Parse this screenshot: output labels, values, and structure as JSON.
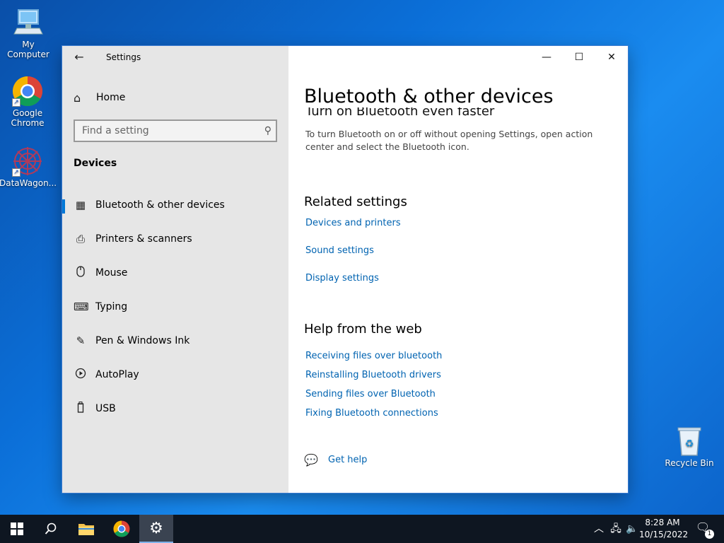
{
  "desktop": {
    "icons": [
      {
        "label": "My Computer",
        "icon": "computer-icon"
      },
      {
        "label": "Google Chrome",
        "icon": "chrome-icon"
      },
      {
        "label": "DataWagon...",
        "icon": "datawagon-icon"
      },
      {
        "label": "Recycle Bin",
        "icon": "recycle-bin-icon"
      }
    ]
  },
  "window": {
    "title": "Settings",
    "back_icon": "back-arrow-icon",
    "home_label": "Home",
    "search_placeholder": "Find a setting",
    "section": "Devices",
    "nav": [
      {
        "label": "Bluetooth & other devices",
        "icon": "bluetooth-devices-icon",
        "active": true
      },
      {
        "label": "Printers & scanners",
        "icon": "printer-icon",
        "active": false
      },
      {
        "label": "Mouse",
        "icon": "mouse-icon",
        "active": false
      },
      {
        "label": "Typing",
        "icon": "keyboard-icon",
        "active": false
      },
      {
        "label": "Pen & Windows Ink",
        "icon": "pen-icon",
        "active": false
      },
      {
        "label": "AutoPlay",
        "icon": "autoplay-icon",
        "active": false
      },
      {
        "label": "USB",
        "icon": "usb-icon",
        "active": false
      }
    ],
    "controls": {
      "minimize": "minimize-icon",
      "maximize": "maximize-icon",
      "close": "close-icon"
    }
  },
  "content": {
    "title": "Bluetooth & other devices",
    "cutoff_heading": "Turn on Bluetooth even faster",
    "description": "To turn Bluetooth on or off without opening Settings, open action center and select the Bluetooth icon.",
    "related_heading": "Related settings",
    "related_links": [
      "Devices and printers",
      "Sound settings",
      "Display settings"
    ],
    "help_heading": "Help from the web",
    "help_links": [
      "Receiving files over bluetooth",
      "Reinstalling Bluetooth drivers",
      "Sending files over Bluetooth",
      "Fixing Bluetooth connections"
    ],
    "get_help": "Get help"
  },
  "taskbar": {
    "time": "8:28 AM",
    "date": "10/15/2022",
    "notification_count": "1"
  },
  "colors": {
    "accent": "#0078d7",
    "link": "#0063b1",
    "sidebar_bg": "#e6e6e6",
    "taskbar_bg": "#0e1621"
  }
}
